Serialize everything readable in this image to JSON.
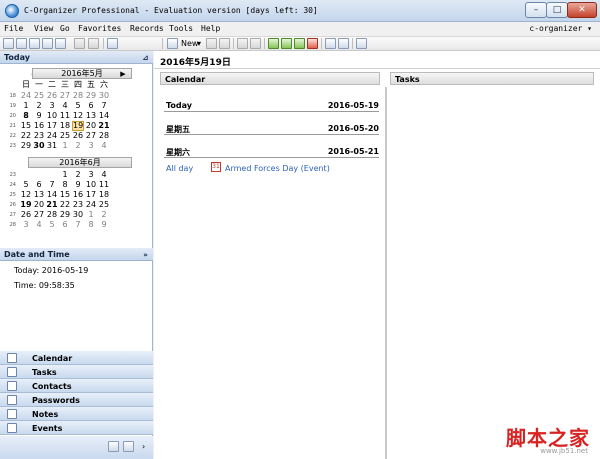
{
  "window": {
    "title": "C-Organizer Professional - Evaluation version [days left: 30]",
    "min_glyph": "–",
    "max_glyph": "□",
    "close_glyph": "✕"
  },
  "menu": {
    "items": [
      "File",
      "View",
      "Go",
      "Favorites",
      "Records",
      "Tools",
      "Help"
    ],
    "brand": "c-organizer ▾"
  },
  "toolbar": {
    "new_label": "New"
  },
  "left": {
    "today_header": "Today",
    "cal1": {
      "month": "2016年5月",
      "dow": [
        "日",
        "一",
        "二",
        "三",
        "四",
        "五",
        "六"
      ],
      "weeks": [
        {
          "wk": "18",
          "days": [
            "24",
            "25",
            "26",
            "27",
            "28",
            "29",
            "30"
          ]
        },
        {
          "wk": "19",
          "days": [
            "1",
            "2",
            "3",
            "4",
            "5",
            "6",
            "7"
          ]
        },
        {
          "wk": "20",
          "days": [
            "8",
            "9",
            "10",
            "11",
            "12",
            "13",
            "14"
          ]
        },
        {
          "wk": "21",
          "days": [
            "15",
            "16",
            "17",
            "18",
            "19",
            "20",
            "21"
          ]
        },
        {
          "wk": "22",
          "days": [
            "22",
            "23",
            "24",
            "25",
            "26",
            "27",
            "28"
          ]
        },
        {
          "wk": "23",
          "days": [
            "29",
            "30",
            "31",
            "1",
            "2",
            "3",
            "4"
          ]
        }
      ]
    },
    "cal2": {
      "month": "2016年6月",
      "weeks": [
        {
          "wk": "23",
          "days": [
            "",
            "",
            "",
            "1",
            "2",
            "3",
            "4"
          ]
        },
        {
          "wk": "24",
          "days": [
            "5",
            "6",
            "7",
            "8",
            "9",
            "10",
            "11"
          ]
        },
        {
          "wk": "25",
          "days": [
            "12",
            "13",
            "14",
            "15",
            "16",
            "17",
            "18"
          ]
        },
        {
          "wk": "26",
          "days": [
            "19",
            "20",
            "21",
            "22",
            "23",
            "24",
            "25"
          ]
        },
        {
          "wk": "27",
          "days": [
            "26",
            "27",
            "28",
            "29",
            "30",
            "1",
            "2"
          ]
        },
        {
          "wk": "28",
          "days": [
            "3",
            "4",
            "5",
            "6",
            "7",
            "8",
            "9"
          ]
        }
      ]
    },
    "datetime_header": "Date and Time",
    "today_line": "Today: 2016-05-19",
    "time_line": "Time: 09:58:35",
    "nav": [
      "Calendar",
      "Tasks",
      "Contacts",
      "Passwords",
      "Notes",
      "Events"
    ]
  },
  "main": {
    "date_title": "2016年5月19日",
    "calendar_header": "Calendar",
    "tasks_header": "Tasks",
    "days": [
      {
        "label": "Today",
        "date": "2016-05-19"
      },
      {
        "label": "星期五",
        "date": "2016-05-20"
      },
      {
        "label": "星期六",
        "date": "2016-05-21"
      }
    ],
    "allday_label": "All day",
    "event_icon_glyph": "31",
    "event_text": "Armed Forces Day (Event)"
  },
  "watermark": {
    "cn": "脚本之家",
    "url": "www.jb51.net"
  },
  "colors": {
    "accent": "#2e64b5",
    "today_highlight": "#fbe2a8",
    "watermark": "#d92323"
  }
}
